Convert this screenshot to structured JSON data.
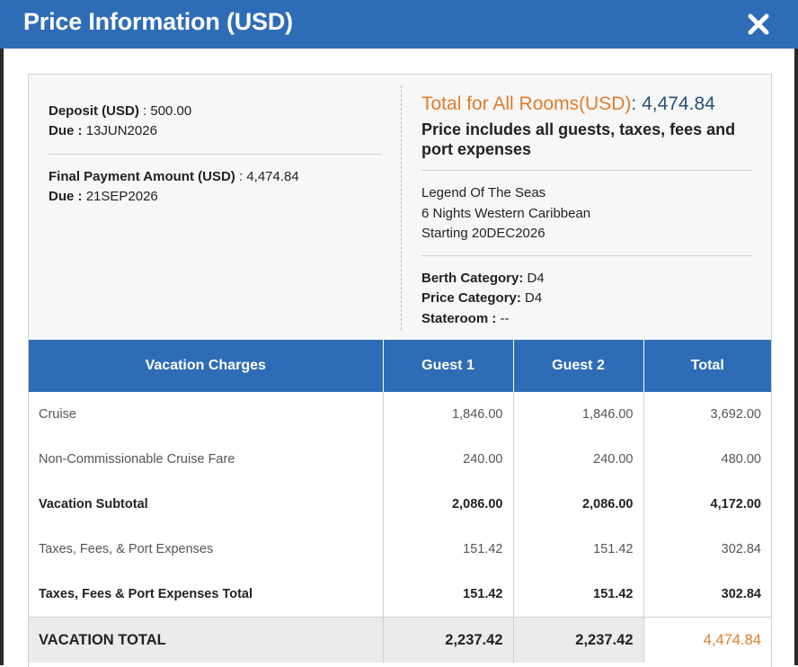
{
  "dialog": {
    "title": "Price Information (USD)"
  },
  "payment": {
    "deposit_label": "Deposit (USD)",
    "deposit_value": "500.00",
    "deposit_due_label": "Due",
    "deposit_due_value": "13JUN2026",
    "final_label": "Final Payment Amount (USD)",
    "final_value": "4,474.84",
    "final_due_label": "Due",
    "final_due_value": "21SEP2026"
  },
  "summary": {
    "total_label": "Total for All Rooms(USD)",
    "total_value": "4,474.84",
    "includes_text": "Price includes all guests, taxes, fees and port expenses",
    "ship": "Legend Of The Seas",
    "itinerary": "6 Nights Western Caribbean",
    "starting": "Starting 20DEC2026",
    "berth_label": "Berth Category:",
    "berth_value": "D4",
    "price_cat_label": "Price Category:",
    "price_cat_value": "D4",
    "stateroom_label": "Stateroom :",
    "stateroom_value": "--"
  },
  "table": {
    "headers": [
      "Vacation Charges",
      "Guest 1",
      "Guest 2",
      "Total"
    ],
    "rows": [
      {
        "desc": "Cruise",
        "g1": "1,846.00",
        "g2": "1,846.00",
        "total": "3,692.00"
      },
      {
        "desc": "Non-Commissionable Cruise Fare",
        "g1": "240.00",
        "g2": "240.00",
        "total": "480.00"
      },
      {
        "desc": "Vacation Subtotal",
        "g1": "2,086.00",
        "g2": "2,086.00",
        "total": "4,172.00"
      },
      {
        "desc": "Taxes, Fees, & Port Expenses",
        "g1": "151.42",
        "g2": "151.42",
        "total": "302.84"
      },
      {
        "desc": "Taxes, Fees & Port Expenses Total",
        "g1": "151.42",
        "g2": "151.42",
        "total": "302.84"
      }
    ],
    "grand": {
      "desc": "VACATION TOTAL",
      "g1": "2,237.42",
      "g2": "2,237.42",
      "total": "4,474.84"
    }
  },
  "colors": {
    "header_blue": "#2e6cb5",
    "accent_orange": "#e07b2b",
    "total_blue": "#2b4f7a"
  },
  "icons": {
    "close": "close-icon"
  }
}
